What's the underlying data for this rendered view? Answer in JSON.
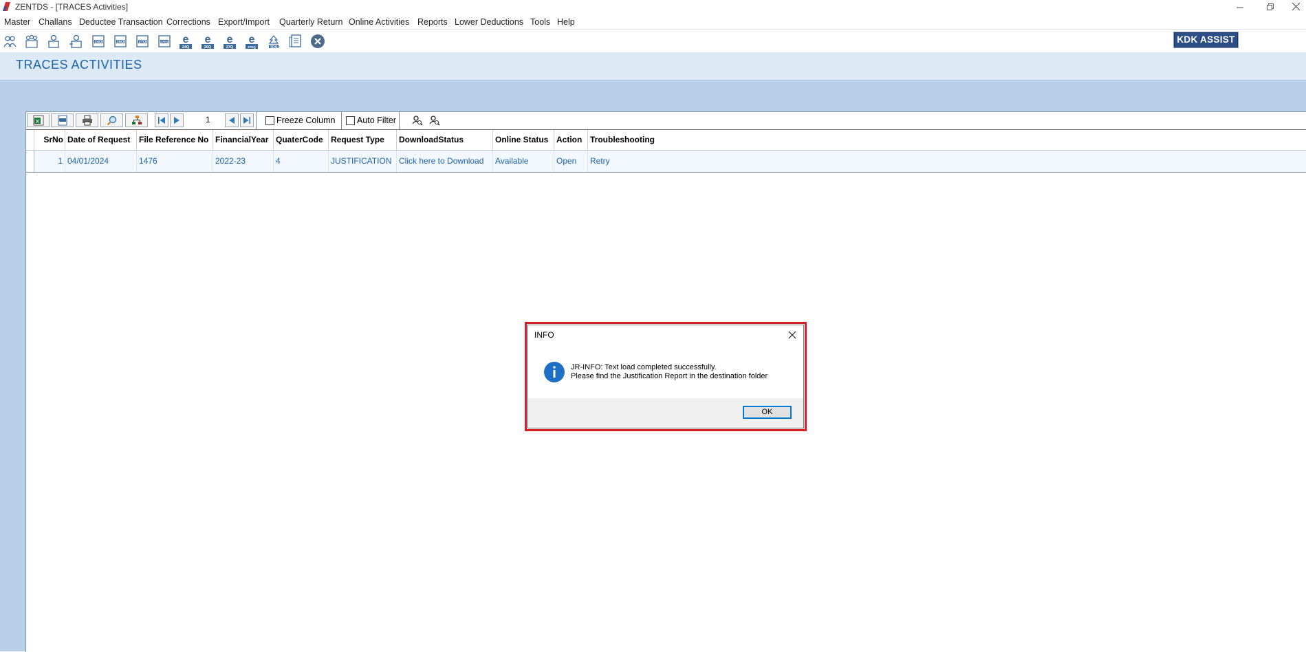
{
  "window": {
    "title": "ZENTDS - [TRACES Activities]"
  },
  "menu": [
    "Master",
    "Challans",
    "Deductee Transaction",
    "Corrections",
    "Export/Import",
    "Quarterly Return",
    "Online Activities",
    "Reports",
    "Lower Deductions",
    "Tools",
    "Help"
  ],
  "toolbar": {
    "icons": [
      "deductor-icon",
      "deductee-group-icon",
      "employee-icon",
      "employee-add-icon",
      "form-24q-icon",
      "form-26q-icon",
      "form-27q-icon",
      "form-27eq-icon",
      "e-24q-icon",
      "e-26q-icon",
      "e-27q-icon",
      "e-27eq-icon",
      "tds-icon",
      "document-icon",
      "close-icon"
    ],
    "icon_labels": [
      "",
      "",
      "",
      "",
      "24Q",
      "26Q",
      "27Q",
      "27EQ",
      "24Q",
      "26Q",
      "27Q",
      "27EQ",
      "TDS",
      "",
      ""
    ],
    "kdk_assist_label": "KDK ASSIST"
  },
  "page": {
    "title": "TRACES ACTIVITIES"
  },
  "grid_toolbar": {
    "page_number": "1",
    "freeze_column_label": "Freeze Column",
    "auto_filter_label": "Auto Filter"
  },
  "table": {
    "columns": [
      "SrNo",
      "Date of Request",
      "File Reference No",
      "FinancialYear",
      "QuaterCode",
      "Request Type",
      "DownloadStatus",
      "Online Status",
      "Action",
      "Troubleshooting"
    ],
    "rows": [
      {
        "srno": "1",
        "date": "04/01/2024",
        "file_ref": "1476",
        "fy": "2022-23",
        "quarter": "4",
        "request_type": "JUSTIFICATION",
        "download_status": "Click here to Download",
        "online_status": "Available",
        "action": "Open",
        "troubleshooting": "Retry"
      }
    ]
  },
  "dialog": {
    "title": "INFO",
    "message_line1": "JR-INFO: Text load completed successfully.",
    "message_line2": "Please find the Justification Report in the destination folder",
    "ok_label": "OK",
    "highlight_color": "#d81e27"
  },
  "colors": {
    "accent": "#1a63ad",
    "background_blue": "#b9d0e8",
    "header_band": "#dde9f5"
  }
}
